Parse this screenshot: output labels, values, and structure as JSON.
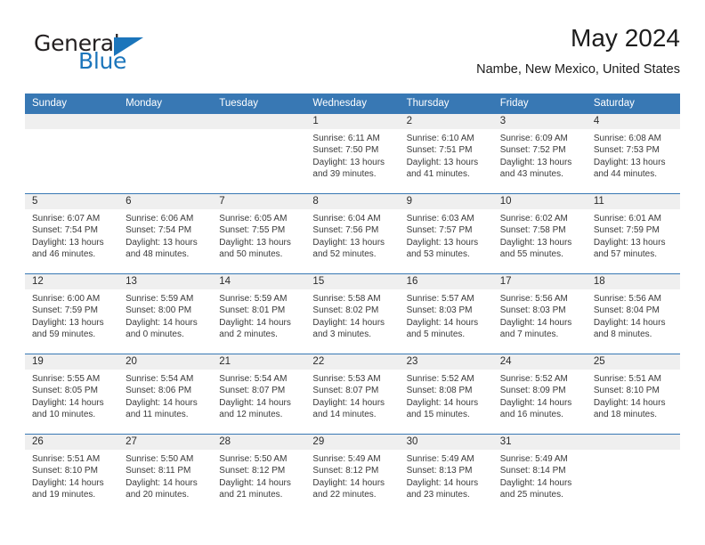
{
  "brand": {
    "name_part1": "General",
    "name_part2": "Blue",
    "flag_icon": "triangle-flag-icon"
  },
  "header": {
    "month_title": "May 2024",
    "location": "Nambe, New Mexico, United States"
  },
  "colors": {
    "header_blue": "#3878b4",
    "brand_blue": "#1b75bb",
    "daynum_band": "#efefef",
    "text": "#2b2b2b"
  },
  "calendar": {
    "weekday_headers": [
      "Sunday",
      "Monday",
      "Tuesday",
      "Wednesday",
      "Thursday",
      "Friday",
      "Saturday"
    ],
    "weeks": [
      [
        {
          "day": "",
          "sunrise": "",
          "sunset": "",
          "daylight": "",
          "empty": true
        },
        {
          "day": "",
          "sunrise": "",
          "sunset": "",
          "daylight": "",
          "empty": true
        },
        {
          "day": "",
          "sunrise": "",
          "sunset": "",
          "daylight": "",
          "empty": true
        },
        {
          "day": "1",
          "sunrise": "Sunrise: 6:11 AM",
          "sunset": "Sunset: 7:50 PM",
          "daylight_line1": "Daylight: 13 hours",
          "daylight_line2": "and 39 minutes."
        },
        {
          "day": "2",
          "sunrise": "Sunrise: 6:10 AM",
          "sunset": "Sunset: 7:51 PM",
          "daylight_line1": "Daylight: 13 hours",
          "daylight_line2": "and 41 minutes."
        },
        {
          "day": "3",
          "sunrise": "Sunrise: 6:09 AM",
          "sunset": "Sunset: 7:52 PM",
          "daylight_line1": "Daylight: 13 hours",
          "daylight_line2": "and 43 minutes."
        },
        {
          "day": "4",
          "sunrise": "Sunrise: 6:08 AM",
          "sunset": "Sunset: 7:53 PM",
          "daylight_line1": "Daylight: 13 hours",
          "daylight_line2": "and 44 minutes."
        }
      ],
      [
        {
          "day": "5",
          "sunrise": "Sunrise: 6:07 AM",
          "sunset": "Sunset: 7:54 PM",
          "daylight_line1": "Daylight: 13 hours",
          "daylight_line2": "and 46 minutes."
        },
        {
          "day": "6",
          "sunrise": "Sunrise: 6:06 AM",
          "sunset": "Sunset: 7:54 PM",
          "daylight_line1": "Daylight: 13 hours",
          "daylight_line2": "and 48 minutes."
        },
        {
          "day": "7",
          "sunrise": "Sunrise: 6:05 AM",
          "sunset": "Sunset: 7:55 PM",
          "daylight_line1": "Daylight: 13 hours",
          "daylight_line2": "and 50 minutes."
        },
        {
          "day": "8",
          "sunrise": "Sunrise: 6:04 AM",
          "sunset": "Sunset: 7:56 PM",
          "daylight_line1": "Daylight: 13 hours",
          "daylight_line2": "and 52 minutes."
        },
        {
          "day": "9",
          "sunrise": "Sunrise: 6:03 AM",
          "sunset": "Sunset: 7:57 PM",
          "daylight_line1": "Daylight: 13 hours",
          "daylight_line2": "and 53 minutes."
        },
        {
          "day": "10",
          "sunrise": "Sunrise: 6:02 AM",
          "sunset": "Sunset: 7:58 PM",
          "daylight_line1": "Daylight: 13 hours",
          "daylight_line2": "and 55 minutes."
        },
        {
          "day": "11",
          "sunrise": "Sunrise: 6:01 AM",
          "sunset": "Sunset: 7:59 PM",
          "daylight_line1": "Daylight: 13 hours",
          "daylight_line2": "and 57 minutes."
        }
      ],
      [
        {
          "day": "12",
          "sunrise": "Sunrise: 6:00 AM",
          "sunset": "Sunset: 7:59 PM",
          "daylight_line1": "Daylight: 13 hours",
          "daylight_line2": "and 59 minutes."
        },
        {
          "day": "13",
          "sunrise": "Sunrise: 5:59 AM",
          "sunset": "Sunset: 8:00 PM",
          "daylight_line1": "Daylight: 14 hours",
          "daylight_line2": "and 0 minutes."
        },
        {
          "day": "14",
          "sunrise": "Sunrise: 5:59 AM",
          "sunset": "Sunset: 8:01 PM",
          "daylight_line1": "Daylight: 14 hours",
          "daylight_line2": "and 2 minutes."
        },
        {
          "day": "15",
          "sunrise": "Sunrise: 5:58 AM",
          "sunset": "Sunset: 8:02 PM",
          "daylight_line1": "Daylight: 14 hours",
          "daylight_line2": "and 3 minutes."
        },
        {
          "day": "16",
          "sunrise": "Sunrise: 5:57 AM",
          "sunset": "Sunset: 8:03 PM",
          "daylight_line1": "Daylight: 14 hours",
          "daylight_line2": "and 5 minutes."
        },
        {
          "day": "17",
          "sunrise": "Sunrise: 5:56 AM",
          "sunset": "Sunset: 8:03 PM",
          "daylight_line1": "Daylight: 14 hours",
          "daylight_line2": "and 7 minutes."
        },
        {
          "day": "18",
          "sunrise": "Sunrise: 5:56 AM",
          "sunset": "Sunset: 8:04 PM",
          "daylight_line1": "Daylight: 14 hours",
          "daylight_line2": "and 8 minutes."
        }
      ],
      [
        {
          "day": "19",
          "sunrise": "Sunrise: 5:55 AM",
          "sunset": "Sunset: 8:05 PM",
          "daylight_line1": "Daylight: 14 hours",
          "daylight_line2": "and 10 minutes."
        },
        {
          "day": "20",
          "sunrise": "Sunrise: 5:54 AM",
          "sunset": "Sunset: 8:06 PM",
          "daylight_line1": "Daylight: 14 hours",
          "daylight_line2": "and 11 minutes."
        },
        {
          "day": "21",
          "sunrise": "Sunrise: 5:54 AM",
          "sunset": "Sunset: 8:07 PM",
          "daylight_line1": "Daylight: 14 hours",
          "daylight_line2": "and 12 minutes."
        },
        {
          "day": "22",
          "sunrise": "Sunrise: 5:53 AM",
          "sunset": "Sunset: 8:07 PM",
          "daylight_line1": "Daylight: 14 hours",
          "daylight_line2": "and 14 minutes."
        },
        {
          "day": "23",
          "sunrise": "Sunrise: 5:52 AM",
          "sunset": "Sunset: 8:08 PM",
          "daylight_line1": "Daylight: 14 hours",
          "daylight_line2": "and 15 minutes."
        },
        {
          "day": "24",
          "sunrise": "Sunrise: 5:52 AM",
          "sunset": "Sunset: 8:09 PM",
          "daylight_line1": "Daylight: 14 hours",
          "daylight_line2": "and 16 minutes."
        },
        {
          "day": "25",
          "sunrise": "Sunrise: 5:51 AM",
          "sunset": "Sunset: 8:10 PM",
          "daylight_line1": "Daylight: 14 hours",
          "daylight_line2": "and 18 minutes."
        }
      ],
      [
        {
          "day": "26",
          "sunrise": "Sunrise: 5:51 AM",
          "sunset": "Sunset: 8:10 PM",
          "daylight_line1": "Daylight: 14 hours",
          "daylight_line2": "and 19 minutes."
        },
        {
          "day": "27",
          "sunrise": "Sunrise: 5:50 AM",
          "sunset": "Sunset: 8:11 PM",
          "daylight_line1": "Daylight: 14 hours",
          "daylight_line2": "and 20 minutes."
        },
        {
          "day": "28",
          "sunrise": "Sunrise: 5:50 AM",
          "sunset": "Sunset: 8:12 PM",
          "daylight_line1": "Daylight: 14 hours",
          "daylight_line2": "and 21 minutes."
        },
        {
          "day": "29",
          "sunrise": "Sunrise: 5:49 AM",
          "sunset": "Sunset: 8:12 PM",
          "daylight_line1": "Daylight: 14 hours",
          "daylight_line2": "and 22 minutes."
        },
        {
          "day": "30",
          "sunrise": "Sunrise: 5:49 AM",
          "sunset": "Sunset: 8:13 PM",
          "daylight_line1": "Daylight: 14 hours",
          "daylight_line2": "and 23 minutes."
        },
        {
          "day": "31",
          "sunrise": "Sunrise: 5:49 AM",
          "sunset": "Sunset: 8:14 PM",
          "daylight_line1": "Daylight: 14 hours",
          "daylight_line2": "and 25 minutes."
        },
        {
          "day": "",
          "sunrise": "",
          "sunset": "",
          "daylight": "",
          "empty": true
        }
      ]
    ]
  }
}
